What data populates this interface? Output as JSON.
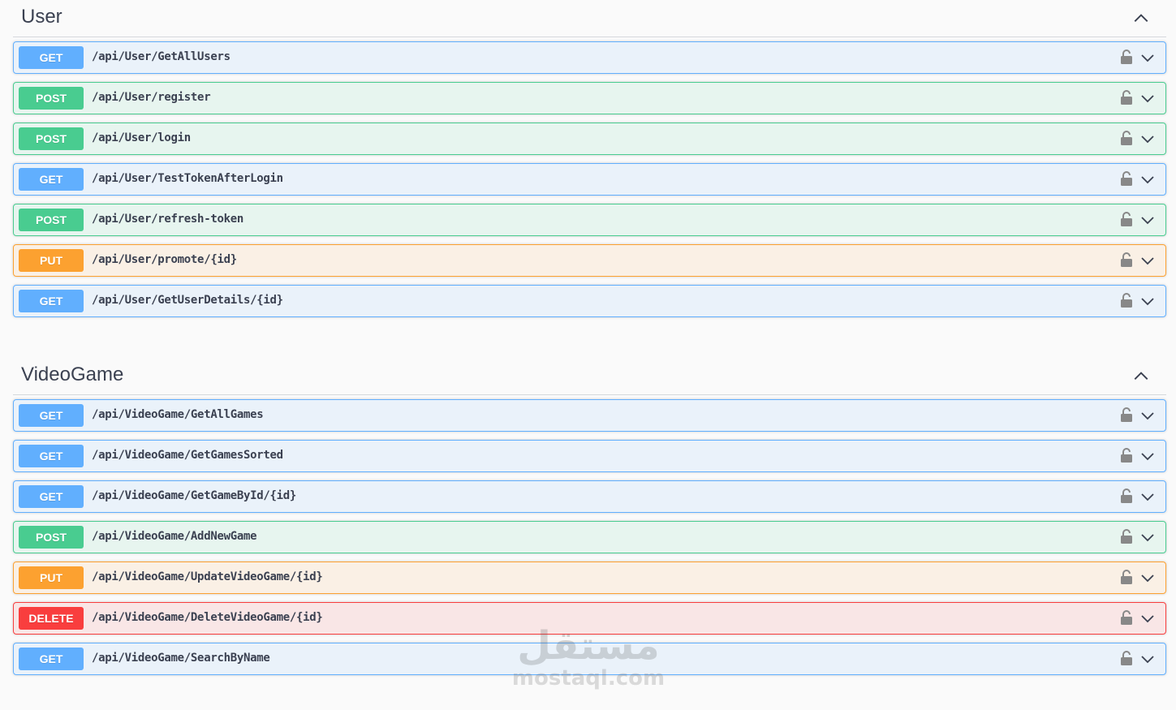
{
  "sections": [
    {
      "title": "User",
      "operations": [
        {
          "method": "GET",
          "path": "/api/User/GetAllUsers"
        },
        {
          "method": "POST",
          "path": "/api/User/register"
        },
        {
          "method": "POST",
          "path": "/api/User/login"
        },
        {
          "method": "GET",
          "path": "/api/User/TestTokenAfterLogin"
        },
        {
          "method": "POST",
          "path": "/api/User/refresh-token"
        },
        {
          "method": "PUT",
          "path": "/api/User/promote/{id}"
        },
        {
          "method": "GET",
          "path": "/api/User/GetUserDetails/{id}"
        }
      ]
    },
    {
      "title": "VideoGame",
      "operations": [
        {
          "method": "GET",
          "path": "/api/VideoGame/GetAllGames"
        },
        {
          "method": "GET",
          "path": "/api/VideoGame/GetGamesSorted"
        },
        {
          "method": "GET",
          "path": "/api/VideoGame/GetGameById/{id}"
        },
        {
          "method": "POST",
          "path": "/api/VideoGame/AddNewGame"
        },
        {
          "method": "PUT",
          "path": "/api/VideoGame/UpdateVideoGame/{id}"
        },
        {
          "method": "DELETE",
          "path": "/api/VideoGame/DeleteVideoGame/{id}"
        },
        {
          "method": "GET",
          "path": "/api/VideoGame/SearchByName"
        }
      ]
    }
  ],
  "method_colors": {
    "GET": "#61affe",
    "POST": "#49cc90",
    "PUT": "#fca130",
    "DELETE": "#f93e3e"
  },
  "icons": {
    "section_toggle": "chevron-up-icon",
    "operation_lock": "lock-icon",
    "operation_expand": "chevron-down-icon"
  },
  "watermark": {
    "arabic": "مستقل",
    "latin": "mostaql.com"
  }
}
